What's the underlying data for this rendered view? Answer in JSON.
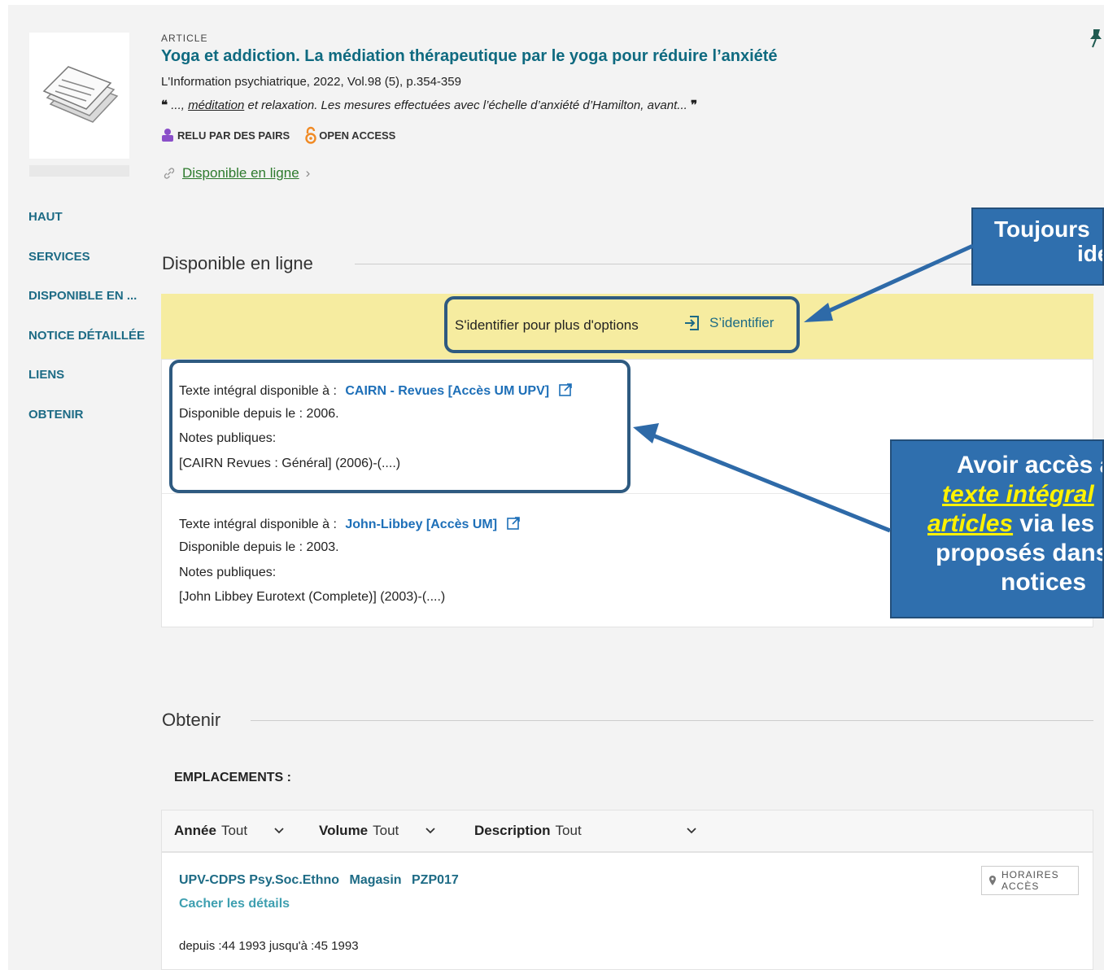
{
  "article": {
    "type_label": "ARTICLE",
    "title": "Yoga et addiction. La médiation thérapeutique par le yoga pour réduire l’anxiété",
    "source": "L'Information psychiatrique, 2022, Vol.98 (5), p.354-359",
    "quote_before": "..., ",
    "quote_highlight": "méditation",
    "quote_after": " et relaxation. Les mesures effectuées avec l’échelle d’anxiété d’Hamilton, avant...",
    "badges": [
      {
        "label": "RELU PAR DES PAIRS",
        "icon": "peer-reviewed-icon",
        "color": "#8a4fc9"
      },
      {
        "label": "OPEN ACCESS",
        "icon": "open-access-icon",
        "color": "#f08a24"
      }
    ],
    "online_link": "Disponible en ligne"
  },
  "sidenav": {
    "items": [
      "HAUT",
      "SERVICES",
      "DISPONIBLE EN ...",
      "NOTICE DÉTAILLÉE",
      "LIENS",
      "OBTENIR"
    ]
  },
  "online_section": {
    "heading": "Disponible en ligne",
    "login_prompt": "S'identifier pour plus d'options",
    "login_button": "S’identifier",
    "services": [
      {
        "prefix": "Texte intégral disponible à :",
        "link": "CAIRN - Revues [Accès UM UPV]",
        "since": "Disponible depuis le : 2006.",
        "notes_label": "Notes publiques:",
        "notes": "[CAIRN Revues : Général] (2006)-(....)"
      },
      {
        "prefix": "Texte intégral disponible à :",
        "link": "John-Libbey [Accès UM]",
        "since": "Disponible depuis le : 2003.",
        "notes_label": "Notes publiques:",
        "notes": "[John Libbey Eurotext (Complete)] (2003)-(....)"
      }
    ]
  },
  "obtain_section": {
    "heading": "Obtenir",
    "locations_title": "EMPLACEMENTS :",
    "filters": [
      {
        "label": "Année",
        "value": "Tout"
      },
      {
        "label": "Volume",
        "value": "Tout"
      },
      {
        "label": "Description",
        "value": "Tout"
      }
    ],
    "location": {
      "library": "UPV-CDPS Psy.Soc.Ethno",
      "collection": "Magasin",
      "call_number": "PZP017",
      "hide_details": "Cacher les détails",
      "holdings": "depuis :44 1993 jusqu'à :45 1993",
      "hours_line1": "HORAIRES",
      "hours_line2": "ACCÈS"
    }
  },
  "annotations": {
    "callout1_line1": "Toujours",
    "callout1_line2": "ide",
    "callout2_line1": "Avoir accès a",
    "callout2_line2": "texte intégral",
    "callout2_line3a": "articles",
    "callout2_line3b": " via les",
    "callout2_line4": "proposés dans",
    "callout2_line5": "notices"
  },
  "colors": {
    "accent": "#1d6b85",
    "link_blue": "#1d6fb8",
    "available_green": "#2d7a2d",
    "banner_yellow": "#f6eca0",
    "annotation_blue": "#2f6fae"
  }
}
